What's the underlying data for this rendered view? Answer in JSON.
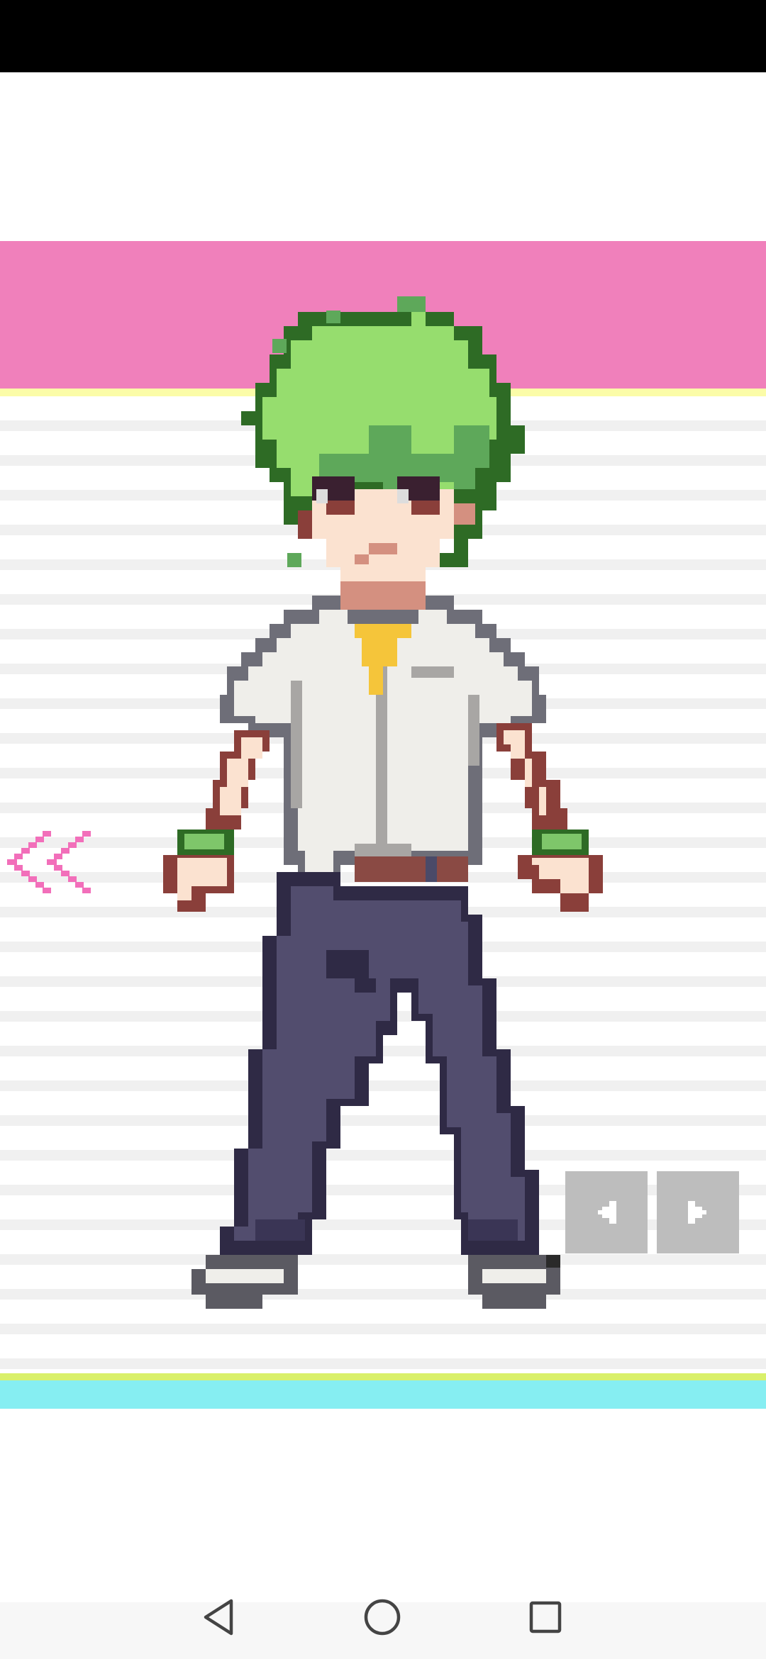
{
  "app": {
    "screen": "character-viewer"
  },
  "colors": {
    "status_bar": "#000000",
    "pink_band": "#f080bb",
    "yellow_line": "#fbfca8",
    "stripe": "#f0f0f0",
    "green_line": "#d9f06a",
    "cyan_band": "#86eef2",
    "nav_bar": "#f7f7f7",
    "back_chevron": "#f26fba",
    "step_button": "#bdbdbd",
    "step_arrow": "#ffffff"
  },
  "character": {
    "description_icon": "pixel-art-character-green-hair"
  },
  "controls": {
    "back_icon": "double-chevron-left-icon",
    "prev_icon": "caret-left-icon",
    "next_icon": "caret-right-icon"
  },
  "system_nav": {
    "back_icon": "triangle-back-icon",
    "home_icon": "circle-home-icon",
    "recents_icon": "square-recents-icon"
  }
}
